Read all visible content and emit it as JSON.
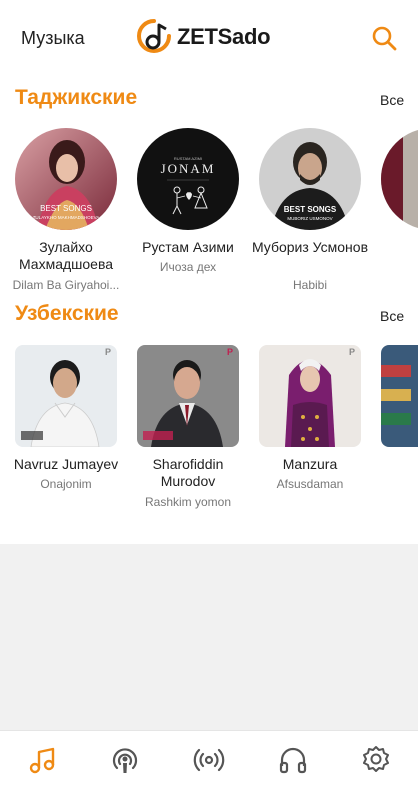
{
  "header": {
    "title": "Музыка",
    "logo_text": "ZETSado",
    "search_icon": "search-icon"
  },
  "sections": [
    {
      "title": "Таджикские",
      "see_all": "Все",
      "items": [
        {
          "name": "Зулайхо Махмадшоева",
          "subtitle": "Dilam Ba Giryahoi..."
        },
        {
          "name": "Рустам Азими",
          "subtitle": "Ичоза дех"
        },
        {
          "name": "Мубориз Усмонов",
          "subtitle": "Habibi"
        }
      ]
    },
    {
      "title": "Узбекские",
      "see_all": "Все",
      "items": [
        {
          "name": "Navruz Jumayev",
          "subtitle": "Onajonim"
        },
        {
          "name": "Sharofiddin Murodov",
          "subtitle": "Rashkim yomon"
        },
        {
          "name": "Manzura",
          "subtitle": "Afsusdaman"
        }
      ]
    }
  ],
  "tabs": [
    {
      "icon": "music-note-icon",
      "active": true
    },
    {
      "icon": "podcast-icon",
      "active": false
    },
    {
      "icon": "radio-broadcast-icon",
      "active": false
    },
    {
      "icon": "headphones-icon",
      "active": false
    },
    {
      "icon": "settings-gear-icon",
      "active": false
    }
  ],
  "colors": {
    "accent": "#ef8a14",
    "text": "#222222",
    "muted": "#777777"
  }
}
